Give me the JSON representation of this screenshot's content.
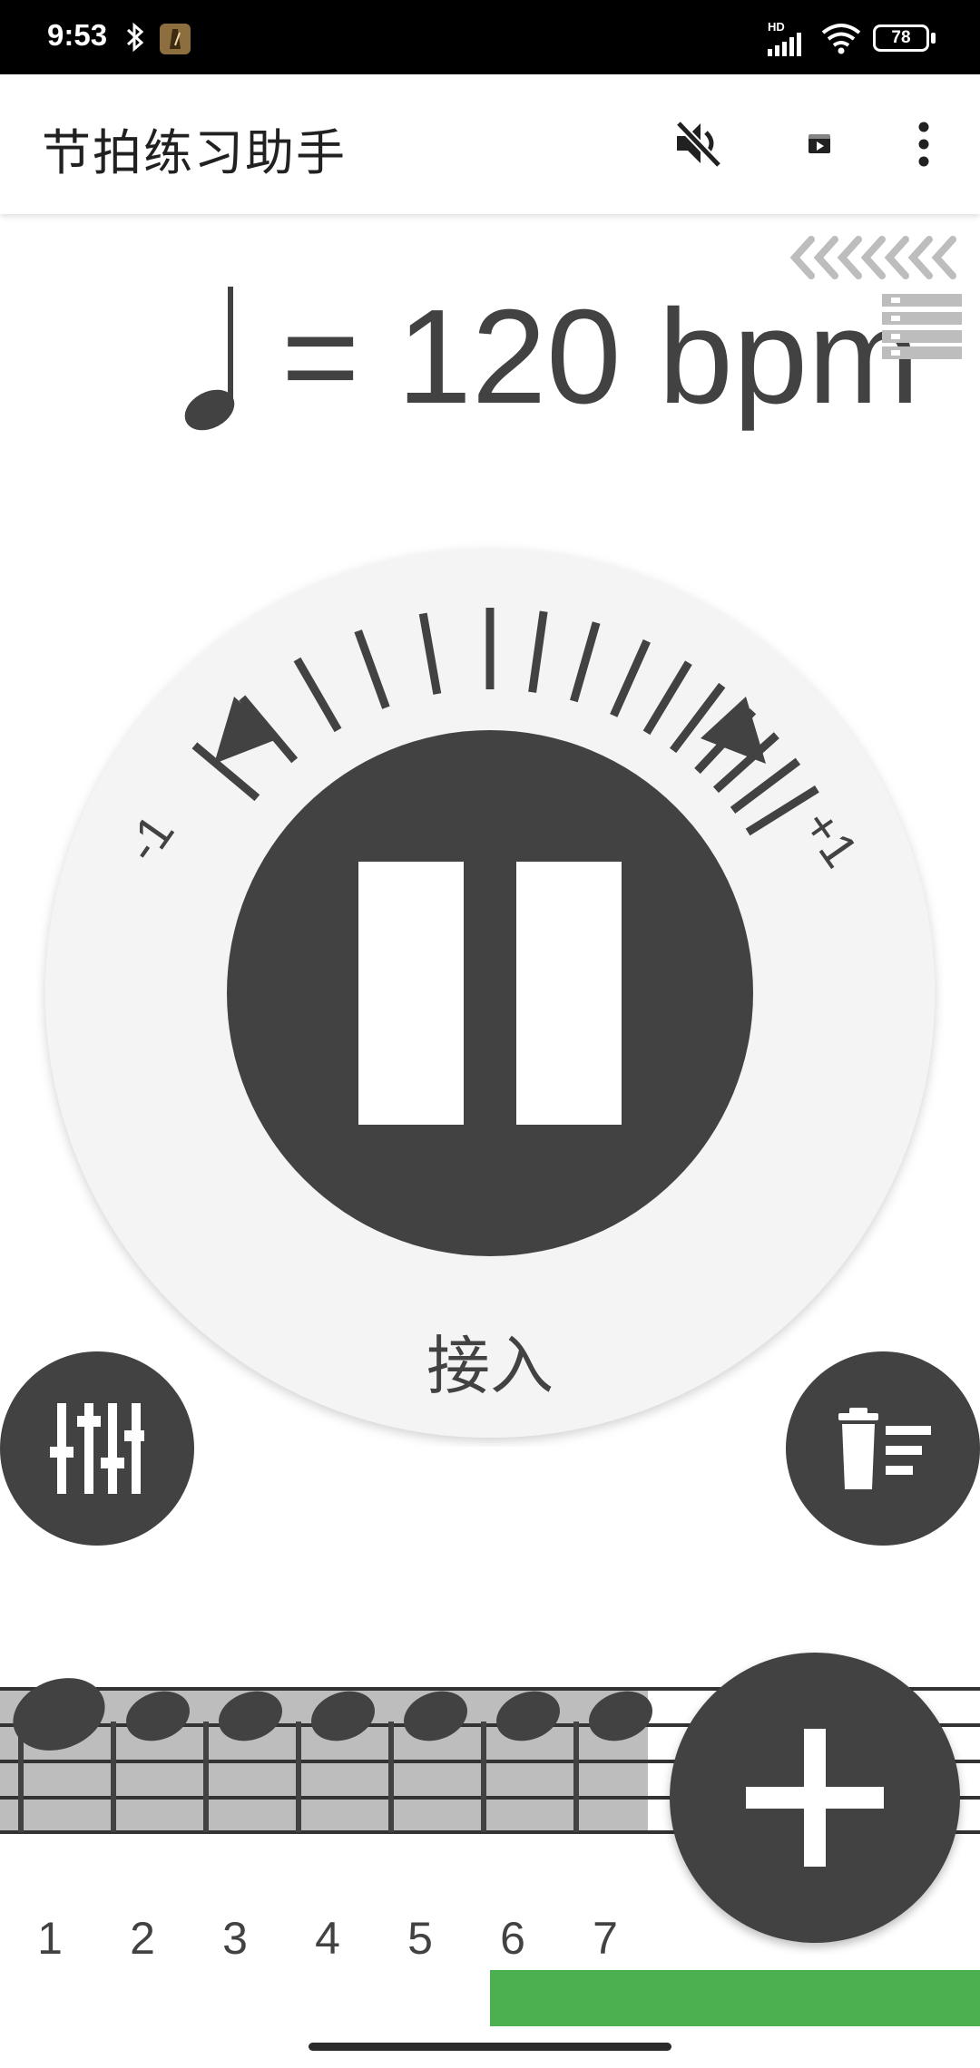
{
  "status_bar": {
    "time": "9:53",
    "battery": "78",
    "network": "HD",
    "icons": [
      "bluetooth-icon",
      "metronome-app-icon",
      "signal-icon",
      "wifi-icon",
      "battery-icon"
    ]
  },
  "app_bar": {
    "title": "节拍练习助手",
    "actions": [
      "volume-off-icon",
      "video-icon",
      "more-vert-icon"
    ]
  },
  "tempo": {
    "value_text": "= 120 bpm",
    "note_icon": "quarter-note-icon"
  },
  "dial": {
    "minus_label": "-1",
    "plus_label": "+1",
    "center_state": "pause-icon",
    "tap_label": "接入"
  },
  "beats": {
    "count": 7,
    "labels": [
      "1",
      "2",
      "3",
      "4",
      "5",
      "6",
      "7"
    ],
    "accent_beat": "1"
  },
  "progress": {
    "fraction": 0.5
  },
  "colors": {
    "primary": "#424242",
    "dial_bg": "#f5f5f5",
    "highlight": "#bdbdbd",
    "progress": "#4caf50"
  }
}
